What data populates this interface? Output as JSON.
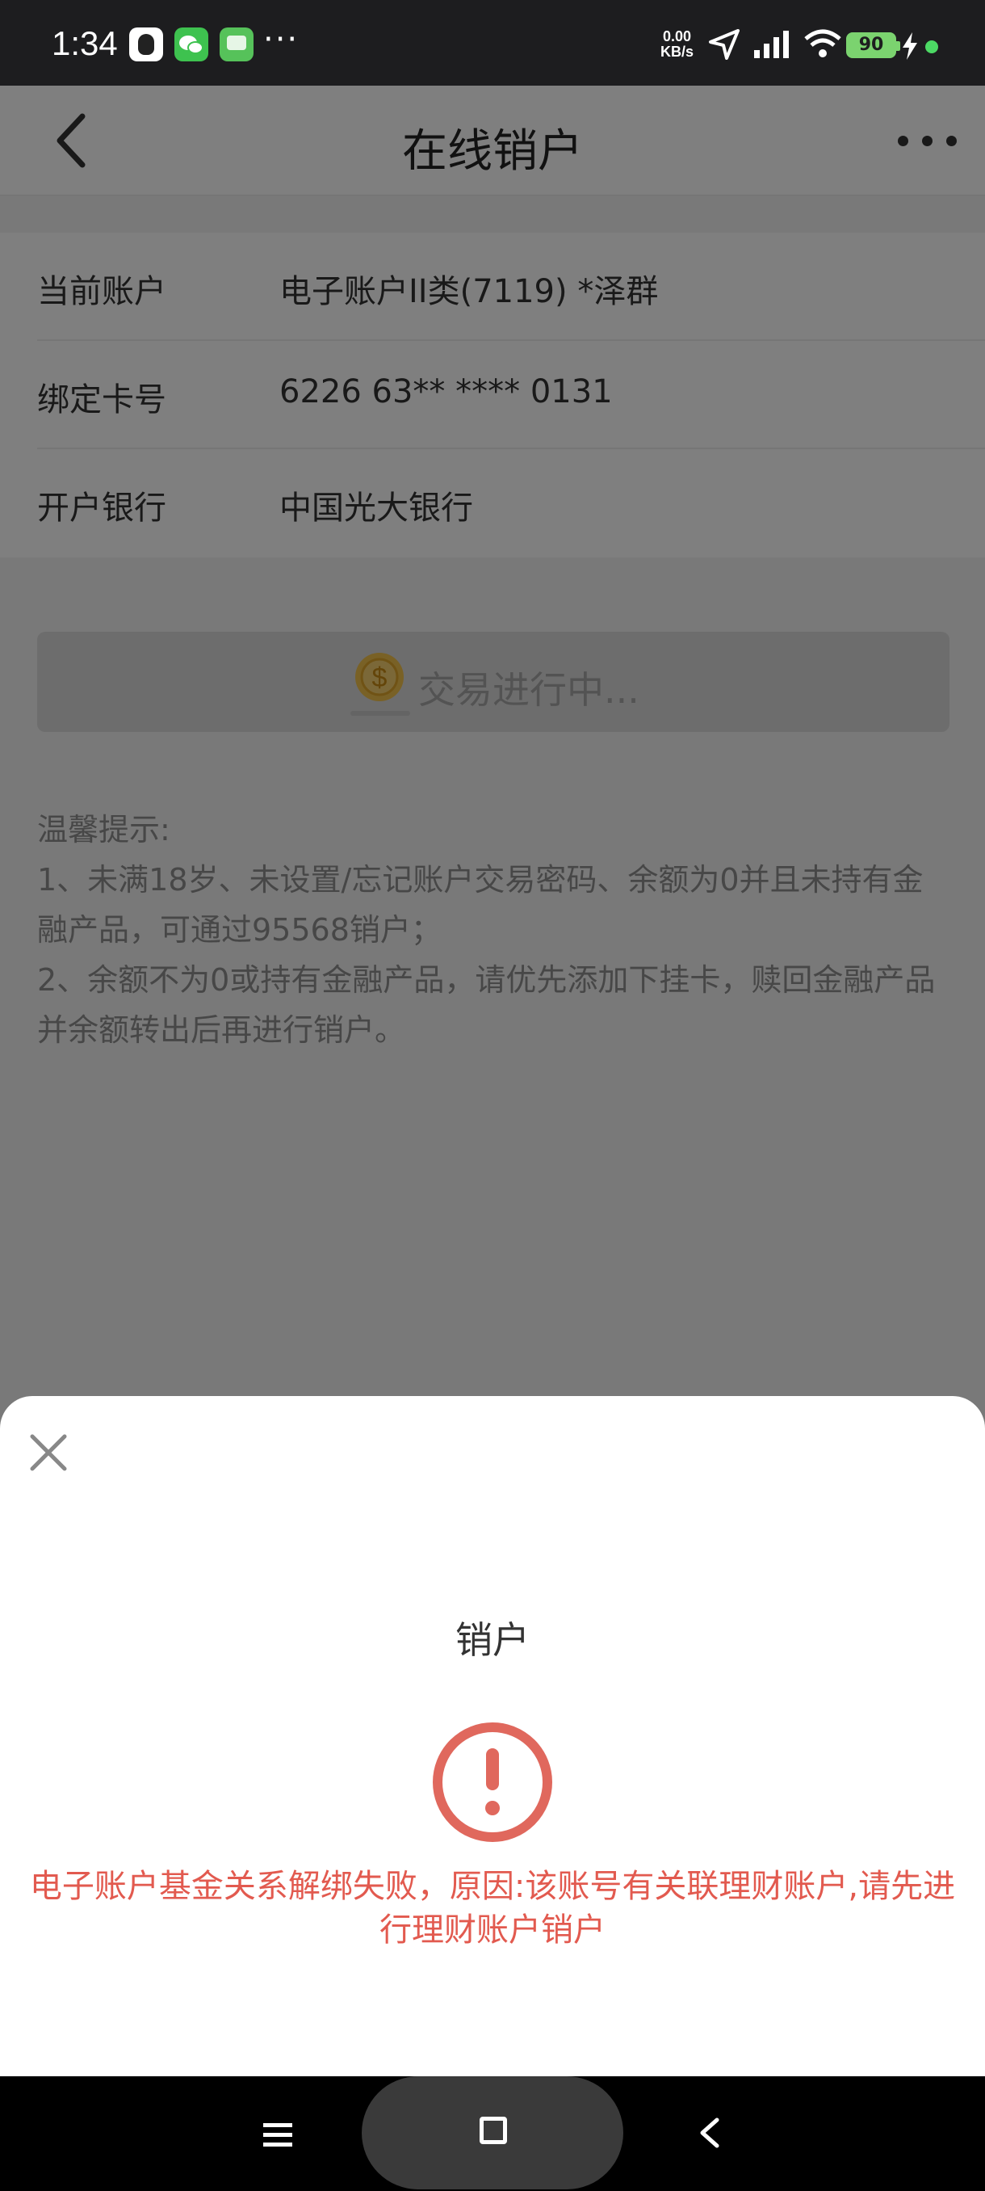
{
  "status_bar": {
    "time": "1:34",
    "more": "···",
    "net_speed_value": "0.00",
    "net_speed_unit": "KB/s",
    "battery": "90",
    "apps": [
      "qq-icon",
      "wechat-icon",
      "messages-icon"
    ]
  },
  "header": {
    "title": "在线销户",
    "back_icon": "chevron-left-icon",
    "more_icon": "more-horizontal-icon"
  },
  "account": {
    "rows": [
      {
        "label": "当前账户",
        "value": "电子账户II类(7119) *泽群"
      },
      {
        "label": "绑定卡号",
        "value": "6226 63** **** 0131"
      },
      {
        "label": "开户银行",
        "value": "中国光大银行"
      }
    ]
  },
  "action": {
    "label": "交易进行中...",
    "icon": "coin-icon",
    "state": "disabled"
  },
  "tips": {
    "title": "温馨提示:",
    "items": [
      "1、未满18岁、未设置/忘记账户交易密码、余额为0并且未持有金融产品，可通过95568销户；",
      "2、余额不为0或持有金融产品，请优先添加下挂卡，赎回金融产品并余额转出后再进行销户。"
    ]
  },
  "dialog": {
    "title": "销户",
    "close_icon": "close-icon",
    "alert_icon": "exclamation-circle-icon",
    "message": "电子账户基金关系解绑失败，原因:该账号有关联理财账户,请先进行理财账户销户"
  },
  "nav_bar": {
    "menu_icon": "menu-icon",
    "home_icon": "home-square-icon",
    "back_icon": "back-icon"
  },
  "colors": {
    "error": "#e25a4f",
    "overlay": "rgba(0,0,0,0.5)",
    "status_bar": "#1d1d1f",
    "battery": "#7bd36f"
  }
}
